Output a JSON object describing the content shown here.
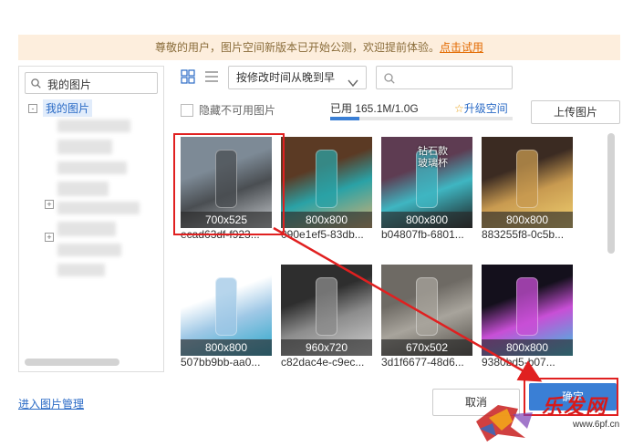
{
  "notice": {
    "text": "尊敬的用户，图片空间新版本已开始公测，欢迎提前体验。",
    "link": "点击试用"
  },
  "sidebar": {
    "search_text": "我的图片",
    "root_label": "我的图片",
    "toggle": "-"
  },
  "toolbar": {
    "sort_label": "按修改时间从晚到早",
    "hide_unavailable": "隐藏不可用图片",
    "usage_text": "已用 165.1M/1.0G",
    "usage_fraction": 0.16,
    "upgrade": "升级空间",
    "upload_button": "上传图片"
  },
  "images": [
    {
      "dim": "700x525",
      "caption": "ecad63df-f923...",
      "colors": [
        "#7d8a96",
        "#4a4e52",
        "#c8ccd0"
      ]
    },
    {
      "dim": "800x800",
      "caption": "090e1ef5-83db...",
      "colors": [
        "#5b3a24",
        "#2aa2a6",
        "#d8b070"
      ]
    },
    {
      "dim": "800x800",
      "caption": "b04807fb-6801...",
      "colors": [
        "#5e3c52",
        "#3fb6c2",
        "#1d1d1d"
      ],
      "overlay": "钻石款\n玻璃杯"
    },
    {
      "dim": "800x800",
      "caption": "883255f8-0c5b...",
      "colors": [
        "#3b2b22",
        "#c89a50",
        "#f0d070"
      ]
    },
    {
      "dim": "800x800",
      "caption": "507bb9bb-aa0...",
      "colors": [
        "#ffffff",
        "#9fc8e6",
        "#2aa6c8"
      ]
    },
    {
      "dim": "960x720",
      "caption": "c82dac4e-c9ec...",
      "colors": [
        "#2e2e2e",
        "#8c8c8c",
        "#d0d0d0"
      ]
    },
    {
      "dim": "670x502",
      "caption": "3d1f6677-48d6...",
      "colors": [
        "#6e6a64",
        "#a8a49c",
        "#4e4a44"
      ]
    },
    {
      "dim": "800x800",
      "caption": "9380bd5-b07...",
      "colors": [
        "#14101c",
        "#c84fd6",
        "#34c6e0"
      ]
    }
  ],
  "footer": {
    "manage_link": "进入图片管理",
    "cancel": "取消",
    "confirm": "确定"
  },
  "watermark": {
    "text": "乐发网",
    "url": "www.6pf.cn"
  },
  "colors": {
    "accent_blue": "#2b6bc6",
    "annotation_red": "#e02020",
    "notice_bg": "#fdeedd",
    "notice_link": "#e36a00"
  }
}
